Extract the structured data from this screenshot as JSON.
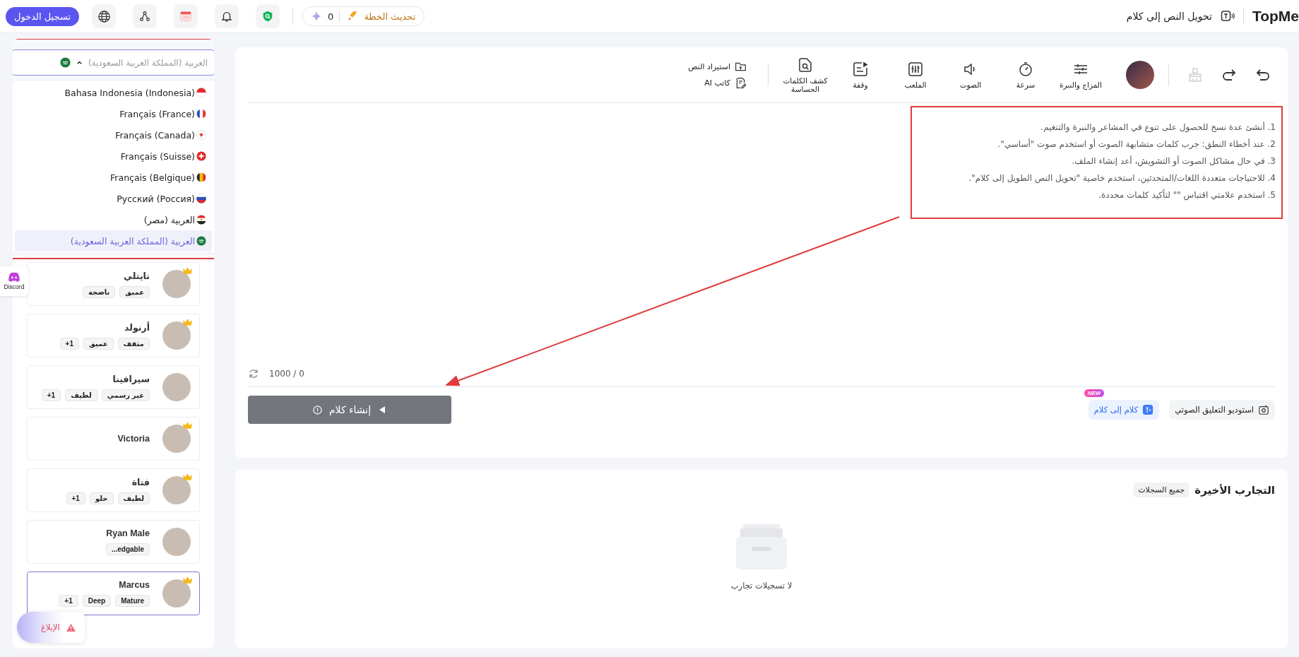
{
  "top_bar": {
    "logo": "TopMe",
    "title": "تحويل النص إلى كلام",
    "upgrade": "تحديث الخطة",
    "credits": "0",
    "login": "تسجيل الدخول"
  },
  "language_select": {
    "value": "العربية (المملكة العربية السعودية)",
    "expanded": true,
    "options": [
      {
        "label": "Bahasa Indonesia (Indonesia)",
        "kind": "id",
        "selected": false
      },
      {
        "label": "Français (France)",
        "kind": "fr",
        "selected": false
      },
      {
        "label": "Français (Canada)",
        "kind": "ca",
        "selected": false
      },
      {
        "label": "Français (Suisse)",
        "kind": "ch",
        "selected": false
      },
      {
        "label": "Français (Belgique)",
        "kind": "be",
        "selected": false
      },
      {
        "label": "Русский (Россия)",
        "kind": "ru",
        "selected": false
      },
      {
        "label": "العربية (مصر)",
        "kind": "eg",
        "selected": false
      },
      {
        "label": "العربية (المملكة العربية السعودية)",
        "kind": "sa",
        "selected": true
      }
    ]
  },
  "voices": [
    {
      "name": "نايتلي",
      "tags": [
        "عميق",
        "ناضجة"
      ],
      "premium": true,
      "selected": false
    },
    {
      "name": "أرنولد",
      "tags": [
        "مثقف",
        "عميق",
        "+1"
      ],
      "premium": true,
      "selected": false
    },
    {
      "name": "سيرافينا",
      "tags": [
        "غير رسمي",
        "لطيف",
        "+1"
      ],
      "premium": false,
      "selected": false
    },
    {
      "name": "Victoria",
      "premium": true,
      "selected": false
    },
    {
      "name": "فتاة",
      "tags": [
        "لطيف",
        "حلو",
        "+1"
      ],
      "premium": true,
      "selected": false
    },
    {
      "name": "Ryan Male",
      "tags": [
        "...edgable"
      ],
      "premium": false,
      "selected": false
    },
    {
      "name": "Marcus",
      "tags": [
        "Mature",
        "Deep",
        "+1"
      ],
      "premium": true,
      "selected": true
    }
  ],
  "history_buttons": [
    {
      "kind": "undo",
      "disabled": false
    },
    {
      "kind": "redo",
      "disabled": false
    },
    {
      "kind": "clear",
      "disabled": true
    }
  ],
  "tools": [
    {
      "kind": "mood",
      "label": "المزاج والنبرة"
    },
    {
      "kind": "speed",
      "label": "سرعة"
    },
    {
      "kind": "voice",
      "label": "الصوت"
    },
    {
      "kind": "pitch",
      "label": "الملعب"
    },
    {
      "kind": "pause",
      "label": "وقفة"
    },
    {
      "kind": "scan",
      "label": "كشف الكلمات الحساسة"
    }
  ],
  "side_tools": [
    {
      "kind": "import",
      "label": "استيراد النص"
    },
    {
      "kind": "writer",
      "label": "كاتب AI"
    }
  ],
  "editor": {
    "tips": [
      "1. أنشئ عدة نسخ للحصول على تنوع في المشاعر والنبرة والتنغيم.",
      "2. عند أخطاء النطق: جرب كلمات متشابهة الصوت أو استخدم صوت \"أساسي\".",
      "3. في حال مشاكل الصوت أو التشويش، أعد إنشاء الملف.",
      "4. للاحتياجات متعددة اللغات/المتحدثين، استخدم خاصية \"تحويل النص الطويل إلى كلام\".",
      "5. استخدم علامتي اقتباس \"\" لتأكيد كلمات محددة."
    ],
    "counter": "0 / 1000"
  },
  "actions": {
    "generate": {
      "label": "إنشاء كلام",
      "disabled": true
    },
    "studio": "استوديو التعليق الصوتي",
    "speech_to_speech": {
      "label": "كلام إلى كلام",
      "badge": "NEW"
    }
  },
  "recent": {
    "title": "التجارب الأخيرة",
    "filter": "جميع السجلات",
    "empty": "لا تسجيلات تجارب"
  },
  "floating": {
    "discord": "Discord",
    "report": "الإبلاغ"
  }
}
